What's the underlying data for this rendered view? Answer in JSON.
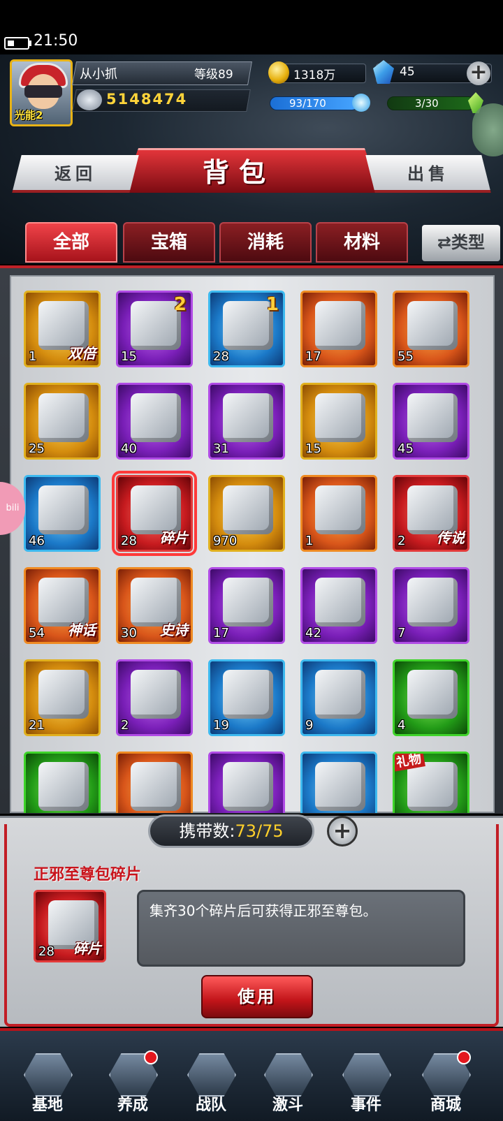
{
  "status": {
    "time": "21:50"
  },
  "player": {
    "name": "从小抓",
    "level": "等级89",
    "power": "5148474",
    "vip": "光能2",
    "gold": "1318万",
    "gems": "45",
    "energy": "93/170",
    "stamina": "3/30"
  },
  "header": {
    "title": "背包",
    "back": "返回",
    "sell": "出售"
  },
  "tabs": {
    "all": "全部",
    "chest": "宝箱",
    "consume": "消耗",
    "material": "材料",
    "type": "⇄类型"
  },
  "items": [
    {
      "count": "1",
      "tag": "双倍",
      "corner": "",
      "ribbon": "",
      "color": "gold"
    },
    {
      "count": "15",
      "tag": "",
      "corner": "2",
      "ribbon": "",
      "color": "purple"
    },
    {
      "count": "28",
      "tag": "",
      "corner": "1",
      "ribbon": "",
      "color": "blue"
    },
    {
      "count": "17",
      "tag": "",
      "corner": "",
      "ribbon": "",
      "color": "orange"
    },
    {
      "count": "55",
      "tag": "",
      "corner": "",
      "ribbon": "",
      "color": "orange"
    },
    {
      "count": "25",
      "tag": "",
      "corner": "",
      "ribbon": "",
      "color": "gold"
    },
    {
      "count": "40",
      "tag": "",
      "corner": "",
      "ribbon": "",
      "color": "purple"
    },
    {
      "count": "31",
      "tag": "",
      "corner": "",
      "ribbon": "",
      "color": "purple"
    },
    {
      "count": "15",
      "tag": "",
      "corner": "",
      "ribbon": "",
      "color": "gold"
    },
    {
      "count": "45",
      "tag": "",
      "corner": "",
      "ribbon": "",
      "color": "purple"
    },
    {
      "count": "46",
      "tag": "",
      "corner": "",
      "ribbon": "",
      "color": "blue"
    },
    {
      "count": "28",
      "tag": "碎片",
      "corner": "",
      "ribbon": "",
      "color": "red"
    },
    {
      "count": "970",
      "tag": "",
      "corner": "",
      "ribbon": "",
      "color": "gold"
    },
    {
      "count": "1",
      "tag": "",
      "corner": "",
      "ribbon": "",
      "color": "orange"
    },
    {
      "count": "2",
      "tag": "传说",
      "corner": "",
      "ribbon": "",
      "color": "red"
    },
    {
      "count": "54",
      "tag": "神话",
      "corner": "",
      "ribbon": "",
      "color": "orange"
    },
    {
      "count": "30",
      "tag": "史诗",
      "corner": "",
      "ribbon": "",
      "color": "orange"
    },
    {
      "count": "17",
      "tag": "",
      "corner": "",
      "ribbon": "",
      "color": "purple"
    },
    {
      "count": "42",
      "tag": "",
      "corner": "",
      "ribbon": "",
      "color": "purple"
    },
    {
      "count": "7",
      "tag": "",
      "corner": "",
      "ribbon": "",
      "color": "purple"
    },
    {
      "count": "21",
      "tag": "",
      "corner": "",
      "ribbon": "",
      "color": "gold"
    },
    {
      "count": "2",
      "tag": "",
      "corner": "",
      "ribbon": "",
      "color": "purple"
    },
    {
      "count": "19",
      "tag": "",
      "corner": "",
      "ribbon": "",
      "color": "blue"
    },
    {
      "count": "9",
      "tag": "",
      "corner": "",
      "ribbon": "",
      "color": "blue"
    },
    {
      "count": "4",
      "tag": "",
      "corner": "",
      "ribbon": "",
      "color": "green"
    },
    {
      "count": "",
      "tag": "",
      "corner": "",
      "ribbon": "",
      "color": "green"
    },
    {
      "count": "",
      "tag": "",
      "corner": "",
      "ribbon": "",
      "color": "orange"
    },
    {
      "count": "",
      "tag": "",
      "corner": "",
      "ribbon": "",
      "color": "purple"
    },
    {
      "count": "",
      "tag": "",
      "corner": "",
      "ribbon": "",
      "color": "blue"
    },
    {
      "count": "",
      "tag": "",
      "corner": "",
      "ribbon": "礼物",
      "color": "green"
    }
  ],
  "selected_index": 11,
  "carry": {
    "label": "携带数:",
    "value": "73/75"
  },
  "detail": {
    "name": "正邪至尊包碎片",
    "count": "28",
    "tag": "碎片",
    "description": "集齐30个碎片后可获得正邪至尊包。",
    "use": "使用"
  },
  "nav": {
    "base": "基地",
    "train": "养成",
    "team": "战队",
    "fight": "激斗",
    "event": "事件",
    "shop": "商城"
  },
  "bili": "bili"
}
